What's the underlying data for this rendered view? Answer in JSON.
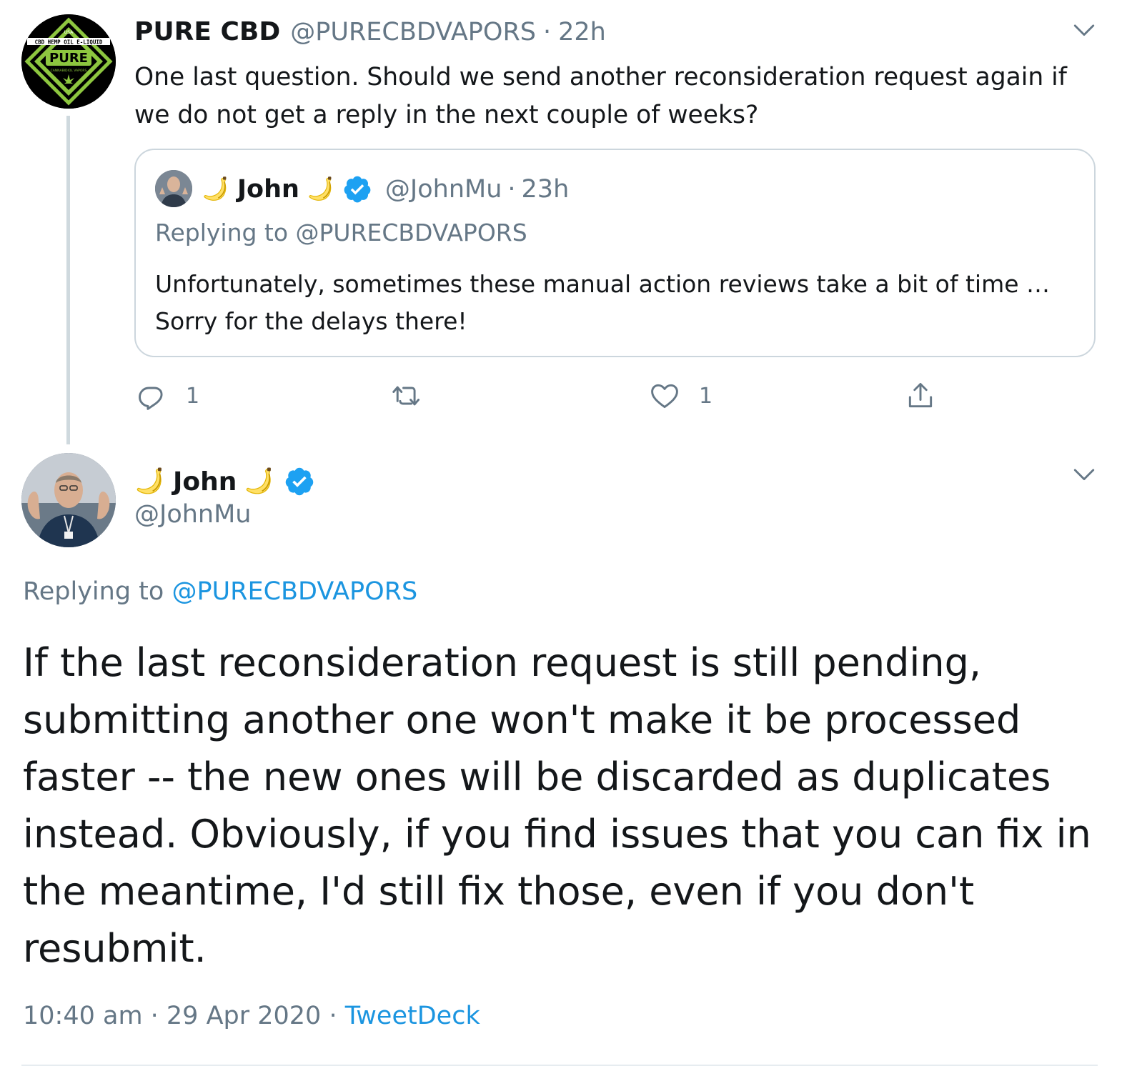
{
  "parent_tweet": {
    "display_name": "PURE CBD",
    "handle": "@PURECBDVAPORS",
    "separator": "·",
    "time": "22h",
    "text": "One last question. Should we send another reconsideration request again if we do not get a reply in the next couple of weeks?",
    "avatar_logo": {
      "top_text": "USA",
      "ribbon_text": "CBD HEMP OIL E-LIQUID",
      "brand_text": "PURE",
      "sub_text": "CANNABIDIOL VAPORS"
    },
    "quoted_tweet": {
      "display_name": "John",
      "handle": "@JohnMu",
      "separator": "·",
      "time": "23h",
      "reply_line": "Replying to @PURECBDVAPORS",
      "text": "Unfortunately, sometimes these manual action reviews take a bit of time … Sorry for the delays there!"
    },
    "actions": {
      "reply_count": "1",
      "retweet_count": "",
      "like_count": "1"
    }
  },
  "main_tweet": {
    "display_name": "John",
    "handle": "@JohnMu",
    "reply_prefix": "Replying to ",
    "reply_mention": "@PURECBDVAPORS",
    "text": "If the last reconsideration request is still pending, submitting another one won't make it be processed faster -- the new ones will be discarded as duplicates instead. Obviously, if you find issues that you can fix in the meantime, I'd still fix those, even if you don't resubmit.",
    "timestamp": "10:40 am · 29 Apr 2020",
    "meta_separator": " · ",
    "source": "TweetDeck"
  },
  "icons": {
    "name_emoji": "banana-icon",
    "verified": "verified-badge-icon",
    "menu": "chevron-down-icon",
    "reply": "reply-icon",
    "retweet": "retweet-icon",
    "like": "heart-icon",
    "share": "share-icon"
  },
  "colors": {
    "text_primary": "#14171a",
    "text_secondary": "#657786",
    "link": "#1b95e0",
    "verified": "#1da1f2",
    "border": "#ccd6dd",
    "thread_line": "#cfd9de",
    "logo_green": "#8dc63f"
  }
}
